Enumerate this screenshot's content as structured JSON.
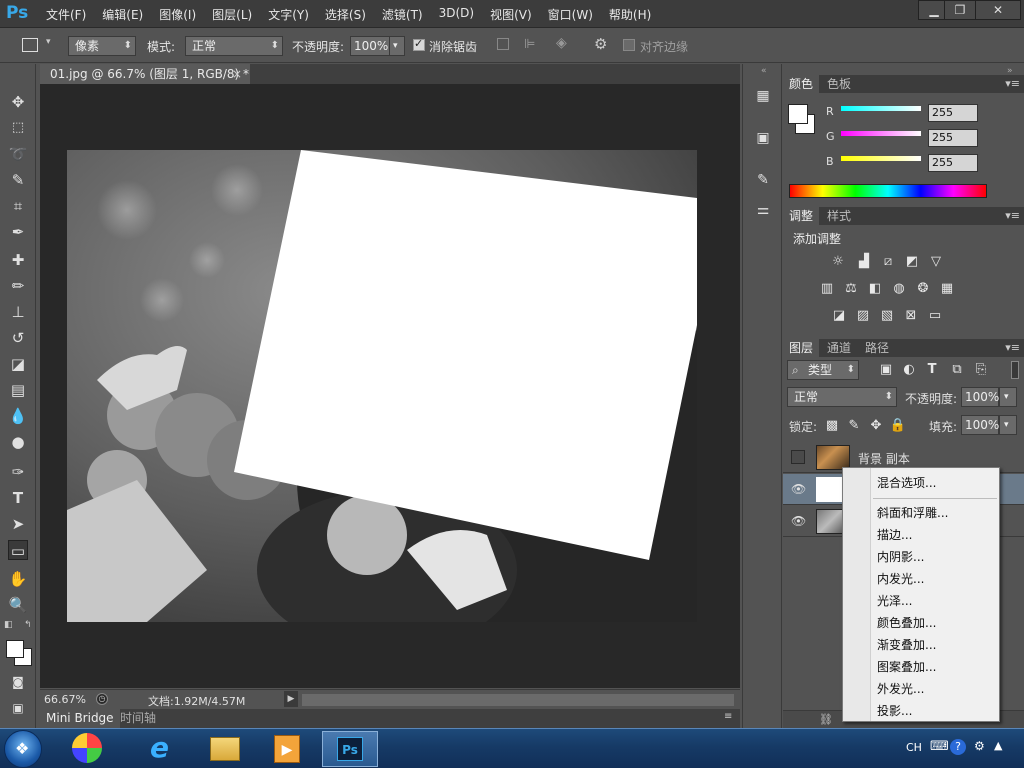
{
  "app": {
    "logo": "Ps",
    "menus": [
      "文件(F)",
      "编辑(E)",
      "图像(I)",
      "图层(L)",
      "文字(Y)",
      "选择(S)",
      "滤镜(T)",
      "3D(D)",
      "视图(V)",
      "窗口(W)",
      "帮助(H)"
    ],
    "window_buttons": [
      "minimize-icon",
      "restore-icon",
      "close-icon"
    ]
  },
  "options": {
    "unit_select": "像素",
    "mode_label": "模式:",
    "mode_select": "正常",
    "opacity_label": "不透明度:",
    "opacity_value": "100%",
    "antialias_label": "消除锯齿",
    "antialias_checked": true,
    "align_edges_label": "对齐边缘",
    "align_edges_checked": false
  },
  "document": {
    "tab_title": "01.jpg @ 66.7% (图层 1, RGB/8) *",
    "zoom": "66.67%",
    "doc_size": "文档:1.92M/4.57M"
  },
  "bottom_tabs": [
    "Mini Bridge",
    "时间轴"
  ],
  "color_panel": {
    "tabs": [
      "颜色",
      "色板"
    ],
    "channels": [
      {
        "label": "R",
        "value": "255"
      },
      {
        "label": "G",
        "value": "255"
      },
      {
        "label": "B",
        "value": "255"
      }
    ]
  },
  "adjust_panel": {
    "tabs": [
      "调整",
      "样式"
    ],
    "heading": "添加调整",
    "icons_row1": [
      "brightness-icon",
      "levels-icon",
      "curves-icon",
      "exposure-icon",
      "vibrance-icon"
    ],
    "icons_row2": [
      "hue-saturation-icon",
      "color-balance-icon",
      "black-white-icon",
      "photo-filter-icon",
      "channel-mixer-icon",
      "color-lookup-icon"
    ],
    "icons_row3": [
      "invert-icon",
      "posterize-icon",
      "threshold-icon",
      "selective-color-icon",
      "gradient-map-icon"
    ]
  },
  "layers_panel": {
    "tabs": [
      "图层",
      "通道",
      "路径"
    ],
    "filter_kind": "类型",
    "blend_mode": "正常",
    "opacity_label": "不透明度:",
    "opacity_value": "100%",
    "lock_label": "锁定:",
    "fill_label": "填充:",
    "fill_value": "100%",
    "layers": [
      {
        "name": "背景 副本",
        "visible": false
      },
      {
        "name": "",
        "visible": true
      },
      {
        "name": "",
        "visible": true
      }
    ]
  },
  "context_menu": {
    "items": [
      "混合选项...",
      "斜面和浮雕...",
      "描边...",
      "内阴影...",
      "内发光...",
      "光泽...",
      "颜色叠加...",
      "渐变叠加...",
      "图案叠加...",
      "外发光...",
      "投影..."
    ]
  },
  "taskbar": {
    "lang": "CH"
  },
  "colors": {
    "ps_blue": "#38a8e8",
    "panel_bg": "#535353",
    "canvas_bg": "#282828"
  }
}
